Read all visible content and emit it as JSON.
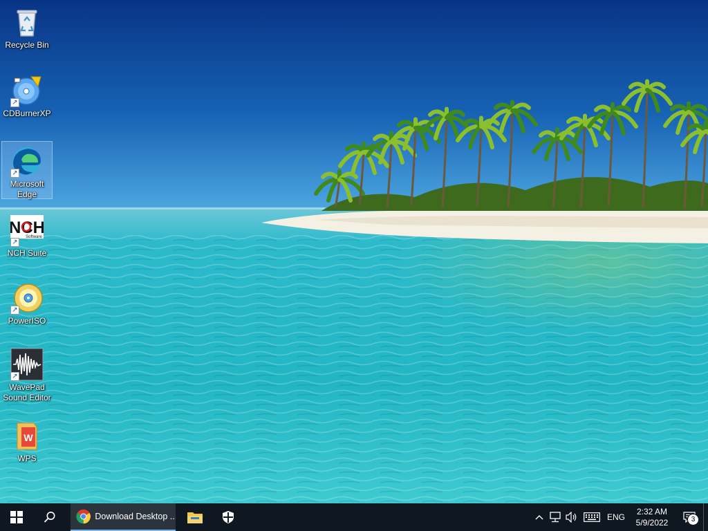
{
  "desktop": {
    "icons": [
      {
        "label": "Recycle Bin",
        "icon": "recycle-bin-icon"
      },
      {
        "label": "CDBurnerXP",
        "icon": "cdburnerxp-icon"
      },
      {
        "label": "Microsoft Edge",
        "icon": "microsoft-edge-icon",
        "selected": true
      },
      {
        "label": "NCH Suite",
        "icon": "nch-suite-icon"
      },
      {
        "label": "PowerISO",
        "icon": "poweriso-icon"
      },
      {
        "label": "WavePad Sound Editor",
        "icon": "wavepad-icon"
      },
      {
        "label": "WPS",
        "icon": "wps-icon"
      }
    ],
    "nch_logo_text": "NCH",
    "nch_sub_text": "Software"
  },
  "taskbar": {
    "start_icon": "windows-start-icon",
    "search_icon": "search-icon",
    "running_app": {
      "label": "Download Desktop ...",
      "icon": "chrome-icon"
    },
    "pinned": [
      {
        "icon": "file-explorer-icon"
      },
      {
        "icon": "windows-security-icon"
      }
    ],
    "tray": {
      "language": "ENG",
      "time": "2:32 AM",
      "date": "5/9/2022",
      "notification_count": "3"
    }
  },
  "colors": {
    "taskbar_bg": "#0f1720",
    "running_app_bg": "#2b333d",
    "running_app_underline": "#7fb6ea",
    "sky_top": "#0a3a8c",
    "sea": "#2fc3d6"
  }
}
